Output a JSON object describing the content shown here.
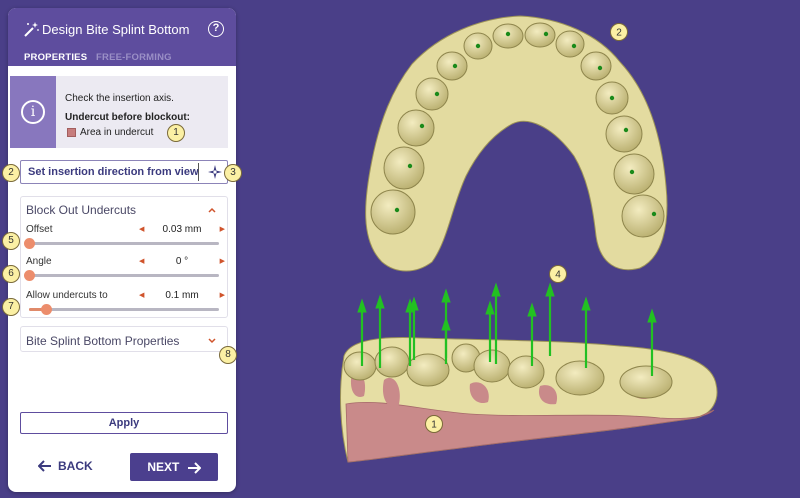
{
  "header": {
    "title": "Design Bite Splint Bottom",
    "help_icon": "?"
  },
  "tabs": [
    {
      "label": "PROPERTIES"
    },
    {
      "label": "FREE-FORMING"
    }
  ],
  "info": {
    "icon": "i",
    "line1": "Check the insertion axis.",
    "line2": "Undercut before blockout:",
    "legend": "Area in undercut",
    "legend_color": "#c77d7d"
  },
  "direction": {
    "label": "Set insertion direction from view"
  },
  "block_out": {
    "title": "Block Out Undercuts",
    "params": [
      {
        "label": "Offset",
        "value": "0.03 mm",
        "level": 0.0
      },
      {
        "label": "Angle",
        "value": "0 °",
        "level": 0.0
      },
      {
        "label": "Allow undercuts to",
        "value": "0.1 mm",
        "level": 0.09
      }
    ]
  },
  "props_section": {
    "title": "Bite Splint Bottom Properties"
  },
  "buttons": {
    "apply": "Apply",
    "back": "BACK",
    "next": "NEXT"
  },
  "callouts": [
    "1",
    "2",
    "3",
    "4",
    "5",
    "6",
    "7",
    "8",
    "1",
    "2"
  ],
  "colors": {
    "background": "#4a3f88",
    "header": "#5e4d9e",
    "accent": "#ec8d6c",
    "model": "#e6dea0",
    "undercut": "#c77d7d",
    "arrow": "#1fc91f"
  }
}
